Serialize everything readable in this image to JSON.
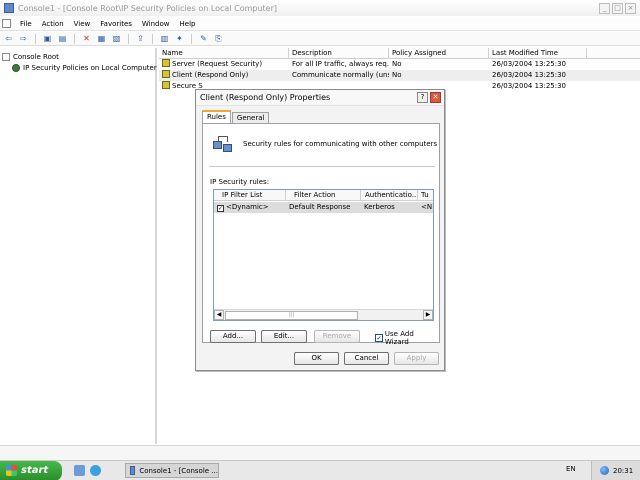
{
  "window": {
    "title": "Console1 - [Console Root\\IP Security Policies on Local Computer]"
  },
  "menu": [
    "File",
    "Action",
    "View",
    "Favorites",
    "Window",
    "Help"
  ],
  "tree": {
    "root": "Console Root",
    "child": "IP Security Policies on Local Computer"
  },
  "list": {
    "columns": [
      "Name",
      "Description",
      "Policy Assigned",
      "Last Modified Time"
    ],
    "rows": [
      {
        "name": "Server (Request Security)",
        "description": "For all IP traffic, always req...",
        "assigned": "No",
        "modified": "26/03/2004 13:25:30"
      },
      {
        "name": "Client (Respond Only)",
        "description": "Communicate normally (uns...",
        "assigned": "No",
        "modified": "26/03/2004 13:25:30"
      },
      {
        "name": "Secure S",
        "description": "",
        "assigned": "",
        "modified": "26/03/2004 13:25:30"
      }
    ]
  },
  "dialog": {
    "title": "Client (Respond Only) Properties",
    "tabs": [
      "Rules",
      "General"
    ],
    "description": "Security rules for communicating with other computers",
    "rules_label": "IP Security rules:",
    "rules_columns": [
      "IP Filter List",
      "Filter Action",
      "Authenticatio...",
      "Tu"
    ],
    "rules_rows": [
      {
        "filter_list": "<Dynamic>",
        "filter_action": "Default Response",
        "auth": "Kerberos",
        "tunnel": "<N"
      }
    ],
    "buttons": {
      "add": "Add...",
      "edit": "Edit...",
      "remove": "Remove",
      "ok": "OK",
      "cancel": "Cancel",
      "apply": "Apply"
    },
    "wizard_label": "Use Add Wizard"
  },
  "taskbar": {
    "start": "start",
    "task": "Console1 - [Console ...",
    "lang": "EN",
    "clock": "20:31"
  }
}
